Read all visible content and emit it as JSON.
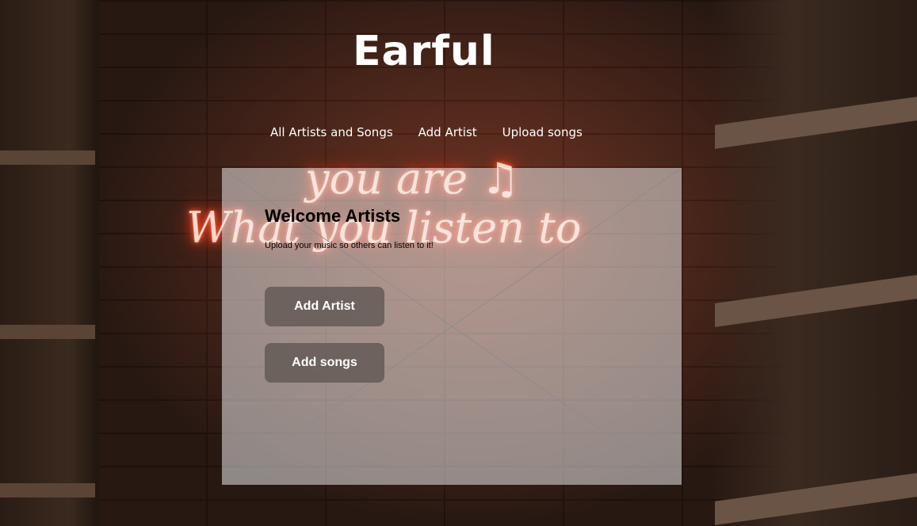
{
  "header": {
    "brand": "Earful"
  },
  "nav": {
    "items": [
      {
        "label": "All Artists and Songs"
      },
      {
        "label": "Add Artist"
      },
      {
        "label": "Upload songs"
      }
    ]
  },
  "background": {
    "neon_line1": "you are ♫",
    "neon_line2": "What you listen to"
  },
  "card": {
    "title": "Welcome Artists",
    "subtitle": "Upload your music so others can listen to it!",
    "add_artist_label": "Add Artist",
    "add_songs_label": "Add songs"
  },
  "colors": {
    "card_bg": "#f0f0f0",
    "button_bg": "#645a56",
    "text_light": "#ffffff",
    "neon_glow": "#ff3b1f"
  }
}
